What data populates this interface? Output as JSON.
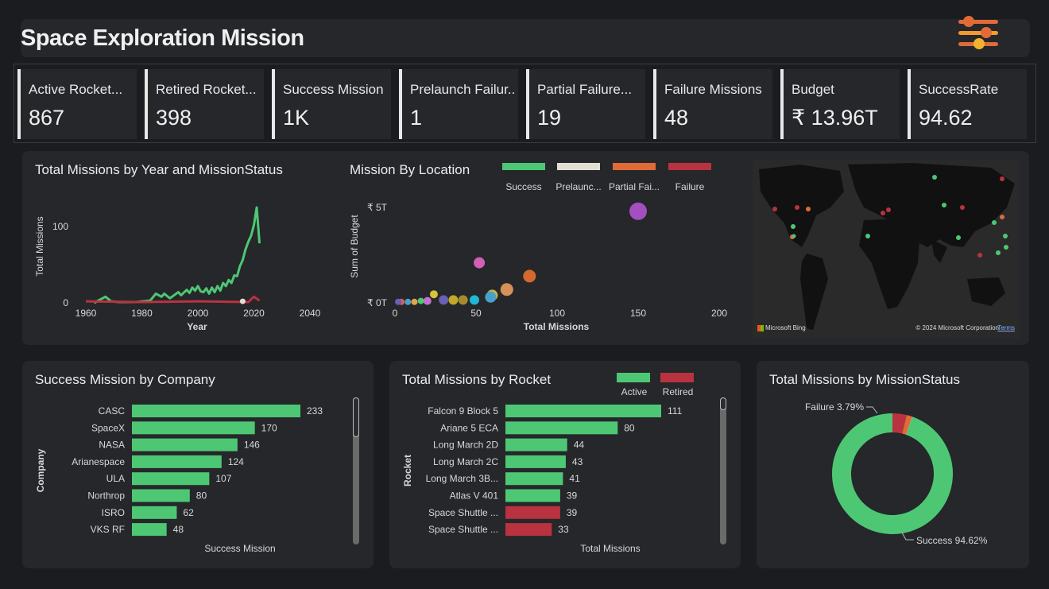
{
  "header": {
    "title": "Space Exploration Mission",
    "filter_icon": "sliders-icon"
  },
  "kpis": [
    {
      "label": "Active Rocket...",
      "value": "867"
    },
    {
      "label": "Retired Rocket...",
      "value": "398"
    },
    {
      "label": "Success Mission",
      "value": "1K"
    },
    {
      "label": "Prelaunch Failur...",
      "value": "1"
    },
    {
      "label": "Partial Failure...",
      "value": "19"
    },
    {
      "label": "Failure Missions",
      "value": "48"
    },
    {
      "label": "Budget",
      "value": "₹ 13.96T"
    },
    {
      "label": "SuccessRate",
      "value": "94.62"
    }
  ],
  "colors": {
    "success": "#4ec774",
    "prelaunch": "#e3ded4",
    "partial": "#e06b36",
    "failure": "#b8333f",
    "active": "#4ec774",
    "retired": "#b8333f"
  },
  "map": {
    "bing": "Microsoft Bing",
    "copyright": "© 2024 Microsoft Corporation",
    "terms": "Terms"
  },
  "chart_data": [
    {
      "type": "line",
      "title": "Total Missions by Year and MissionStatus",
      "xlabel": "Year",
      "ylabel": "Total Missions",
      "xlim": [
        1960,
        2040
      ],
      "ylim": [
        0,
        130
      ],
      "xticks": [
        "1960",
        "1980",
        "2000",
        "2020",
        "2040"
      ],
      "yticks": [
        "0",
        "100"
      ],
      "series": [
        {
          "name": "Success",
          "x": [
            1963,
            1967,
            1969,
            1972,
            1978,
            1983,
            1985,
            1987,
            1988,
            1990,
            1993,
            1994,
            1996,
            1997,
            1998,
            1999,
            2000,
            2001,
            2002,
            2003,
            2004,
            2005,
            2006,
            2007,
            2008,
            2009,
            2010,
            2011,
            2012,
            2013,
            2014,
            2015,
            2016,
            2017,
            2018,
            2019,
            2020,
            2021,
            2022
          ],
          "y": [
            0,
            8,
            2,
            1,
            1,
            3,
            12,
            8,
            12,
            6,
            14,
            10,
            17,
            13,
            20,
            16,
            22,
            15,
            14,
            19,
            12,
            20,
            14,
            22,
            16,
            26,
            22,
            30,
            26,
            36,
            35,
            48,
            56,
            70,
            80,
            88,
            102,
            125,
            78
          ]
        },
        {
          "name": "Failure",
          "x": [
            1960,
            1980,
            2000,
            2018,
            2020,
            2022
          ],
          "y": [
            2,
            1,
            2,
            1,
            8,
            3
          ]
        }
      ]
    },
    {
      "type": "scatter",
      "title": "Mission By Location",
      "xlabel": "Total Missions",
      "ylabel": "Sum of Budget",
      "xlim": [
        0,
        200
      ],
      "ylim": [
        0,
        5
      ],
      "xticks": [
        "0",
        "50",
        "100",
        "150",
        "200"
      ],
      "yticks": [
        "₹ 0T",
        "₹ 5T"
      ],
      "legend": [
        "Success",
        "Prelaunc...",
        "Partial Fai...",
        "Failure"
      ],
      "points": [
        {
          "x": 150,
          "y": 4.8,
          "r": 11,
          "color": "#a44fbf"
        },
        {
          "x": 52,
          "y": 2.1,
          "r": 7,
          "color": "#d35fb6"
        },
        {
          "x": 83,
          "y": 1.4,
          "r": 8,
          "color": "#d4682f"
        },
        {
          "x": 69,
          "y": 0.7,
          "r": 8,
          "color": "#d6915a"
        },
        {
          "x": 60,
          "y": 0.4,
          "r": 7,
          "color": "#c8b24a"
        },
        {
          "x": 59,
          "y": 0.3,
          "r": 7,
          "color": "#4aa0c8"
        },
        {
          "x": 49,
          "y": 0.15,
          "r": 6,
          "color": "#1fb8d6"
        },
        {
          "x": 42,
          "y": 0.15,
          "r": 6,
          "color": "#a68b2a"
        },
        {
          "x": 36,
          "y": 0.15,
          "r": 6,
          "color": "#c4a82a"
        },
        {
          "x": 30,
          "y": 0.15,
          "r": 6,
          "color": "#6a5fb0"
        },
        {
          "x": 24,
          "y": 0.45,
          "r": 5,
          "color": "#d7c23a"
        },
        {
          "x": 20,
          "y": 0.1,
          "r": 5,
          "color": "#c46fd0"
        },
        {
          "x": 16,
          "y": 0.1,
          "r": 4,
          "color": "#4ec774"
        },
        {
          "x": 12,
          "y": 0.05,
          "r": 4,
          "color": "#e0a64a"
        },
        {
          "x": 8,
          "y": 0.05,
          "r": 4,
          "color": "#4aa0c8"
        },
        {
          "x": 4,
          "y": 0.05,
          "r": 4,
          "color": "#d35f5f"
        },
        {
          "x": 2,
          "y": 0.05,
          "r": 4,
          "color": "#6a5fb0"
        }
      ]
    },
    {
      "type": "bar",
      "title": "Success Mission by Company",
      "xlabel": "Success Mission",
      "ylabel": "Company",
      "categories": [
        "CASC",
        "SpaceX",
        "NASA",
        "Arianespace",
        "ULA",
        "Northrop",
        "ISRO",
        "VKS RF"
      ],
      "values": [
        233,
        170,
        146,
        124,
        107,
        80,
        62,
        48
      ],
      "xlim": [
        0,
        233
      ]
    },
    {
      "type": "bar",
      "title": "Total Missions by Rocket",
      "xlabel": "Total Missions",
      "ylabel": "Rocket",
      "legend": [
        "Active",
        "Retired"
      ],
      "categories": [
        "Falcon 9 Block 5",
        "Ariane 5 ECA",
        "Long March 2D",
        "Long March 2C",
        "Long March 3B...",
        "Atlas V 401",
        "Space Shuttle ...",
        "Space Shuttle ..."
      ],
      "values": [
        111,
        80,
        44,
        43,
        41,
        39,
        39,
        33
      ],
      "status": [
        "Active",
        "Active",
        "Active",
        "Active",
        "Active",
        "Active",
        "Retired",
        "Retired"
      ],
      "xlim": [
        0,
        111
      ]
    },
    {
      "type": "pie",
      "title": "Total Missions by MissionStatus",
      "slices": [
        {
          "name": "Success",
          "value": 94.62,
          "label": "Success 94.62%",
          "color": "#4ec774"
        },
        {
          "name": "Failure",
          "value": 3.79,
          "label": "Failure 3.79%",
          "color": "#b8333f"
        },
        {
          "name": "Partial Failure",
          "value": 1.5,
          "color": "#e06b36"
        },
        {
          "name": "Prelaunch Failure",
          "value": 0.09,
          "color": "#e3ded4"
        }
      ]
    }
  ]
}
